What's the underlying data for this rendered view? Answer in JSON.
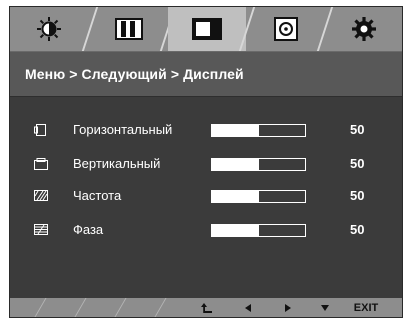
{
  "tabs": [
    {
      "icon": "brightness-icon"
    },
    {
      "icon": "picture-mode-icon"
    },
    {
      "icon": "display-icon",
      "active": true
    },
    {
      "icon": "disc-icon"
    },
    {
      "icon": "gear-icon"
    }
  ],
  "breadcrumb": "Меню > Следующий > Дисплей",
  "rows": [
    {
      "label": "Горизонтальный",
      "value": "50",
      "level": 0.5,
      "icon": "horizontal-position-icon"
    },
    {
      "label": "Вертикальный",
      "value": "50",
      "level": 0.5,
      "icon": "vertical-position-icon"
    },
    {
      "label": "Частота",
      "value": "50",
      "level": 0.5,
      "icon": "clock-pattern-icon"
    },
    {
      "label": "Фаза",
      "value": "50",
      "level": 0.5,
      "icon": "phase-pattern-icon"
    }
  ],
  "footer": {
    "back_icon": "return-arrow-icon",
    "left_icon": "left-arrow-icon",
    "right_icon": "right-arrow-icon",
    "down_icon": "down-arrow-icon",
    "exit_label": "EXIT"
  },
  "colors": {
    "panel": "#3b3b3b",
    "tabbar": "#8d8d8d",
    "tab_active": "#bfbfbf",
    "breadcrumb_bg": "#585858",
    "text": "#ffffff"
  }
}
